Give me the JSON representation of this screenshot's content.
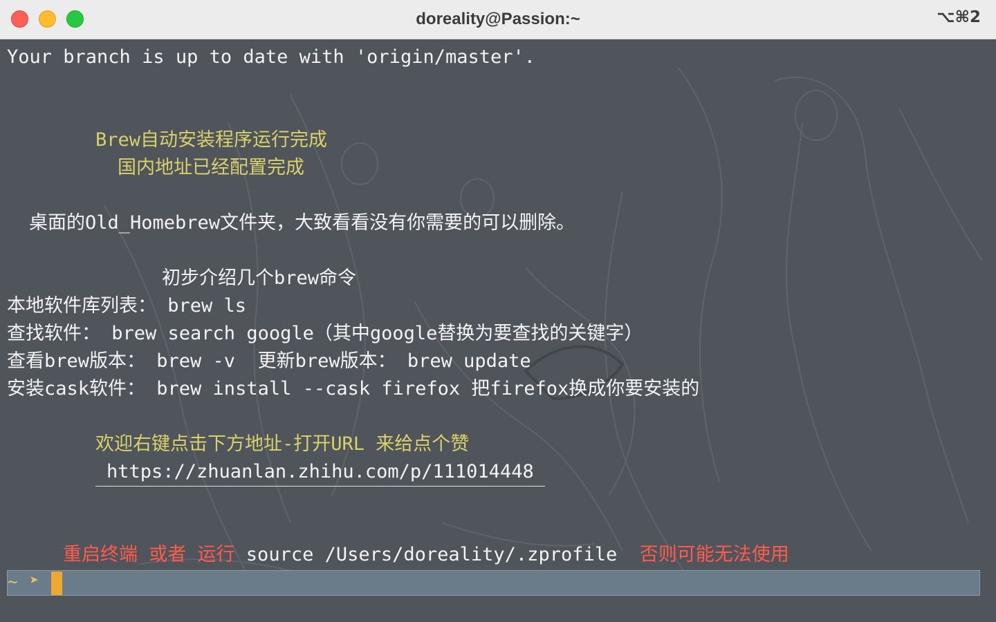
{
  "window": {
    "title": "doreality@Passion:~",
    "shortcut": "⌥⌘2"
  },
  "terminal": {
    "line_branch": "Your branch is up to date with 'origin/master'.",
    "line_done1": "Brew自动安装程序运行完成",
    "line_done2": "国内地址已经配置完成",
    "line_desktop": "桌面的Old_Homebrew文件夹，大致看看没有你需要的可以删除。",
    "line_intro": "初步介绍几个brew命令",
    "line_ls": "本地软件库列表： brew ls",
    "line_search": "查找软件： brew search google（其中google替换为要查找的关键字）",
    "line_version": "查看brew版本： brew -v  更新brew版本： brew update",
    "line_cask": "安装cask软件： brew install --cask firefox 把firefox换成你要安装的",
    "line_welcome": "欢迎右键点击下方地址-打开URL 来给点个赞",
    "url": "https://zhuanlan.zhihu.com/p/111014448",
    "restart_red1": "重启终端 或者 运行",
    "restart_cmd": " source /Users/doreality/.zprofile  ",
    "restart_red2": "否则可能无法使用",
    "prompt_tilde": "~",
    "prompt_arrow": "➤"
  },
  "colors": {
    "terminal_bg": "#50545b",
    "yellow_text": "#d9d26a",
    "red_text": "#ff5b4d",
    "prompt_bar": "#6a7b89",
    "cursor": "#f0a830"
  }
}
